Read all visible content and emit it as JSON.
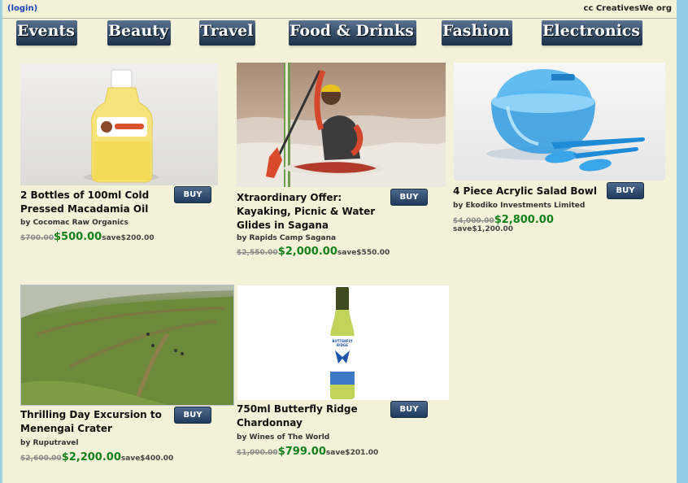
{
  "header": {
    "login_text": "(login)",
    "brand_text": "cc CreativesWe org"
  },
  "nav": [
    "Events",
    "Beauty",
    "Travel",
    "Food & Drinks",
    "Fashion",
    "Electronics"
  ],
  "deals": [
    {
      "title": "2 Bottles of 100ml Cold Pressed Macadamia Oil",
      "buy_label": "BUY",
      "vendor": "by Cocomac Raw Organics",
      "old_price": "$700.00",
      "new_price": "$500.00",
      "save_text": "save$200.00",
      "image": "macadamia-oil-bottle"
    },
    {
      "title": "Xtraordinary Offer: Kayaking, Picnic & Water Glides in Sagana",
      "buy_label": "BUY",
      "vendor": "by Rapids Camp Sagana",
      "old_price": "$2,550.00",
      "new_price": "$2,000.00",
      "save_text": "save$550.00",
      "image": "kayaker-rapids"
    },
    {
      "title": "4 Piece Acrylic Salad Bowl",
      "buy_label": "BUY",
      "vendor": "by Ekodiko Investments Limited",
      "old_price": "$4,000.00",
      "new_price": "$2,800.00",
      "save_text": "save$1,200.00",
      "image": "blue-salad-bowl"
    },
    {
      "title": "Thrilling Day Excursion to Menengai Crater",
      "buy_label": "BUY",
      "vendor": "by Ruputravel",
      "old_price": "$2,600.00",
      "new_price": "$2,200.00",
      "save_text": "save$400.00",
      "image": "green-hillside"
    },
    {
      "title": "750ml Butterfly Ridge Chardonnay",
      "buy_label": "BUY",
      "vendor": "by Wines of The World",
      "old_price": "$1,000.00",
      "new_price": "$799.00",
      "save_text": "save$201.00",
      "image": "wine-bottle",
      "label_text": "BUTTERFLY RIDGE"
    }
  ],
  "colors": {
    "page_bg": "#f3f1d8",
    "nav_tab": "#344b66",
    "price_green": "#13801c",
    "buy_button": "#1f3a5c",
    "login_link": "#1a3fb8"
  }
}
